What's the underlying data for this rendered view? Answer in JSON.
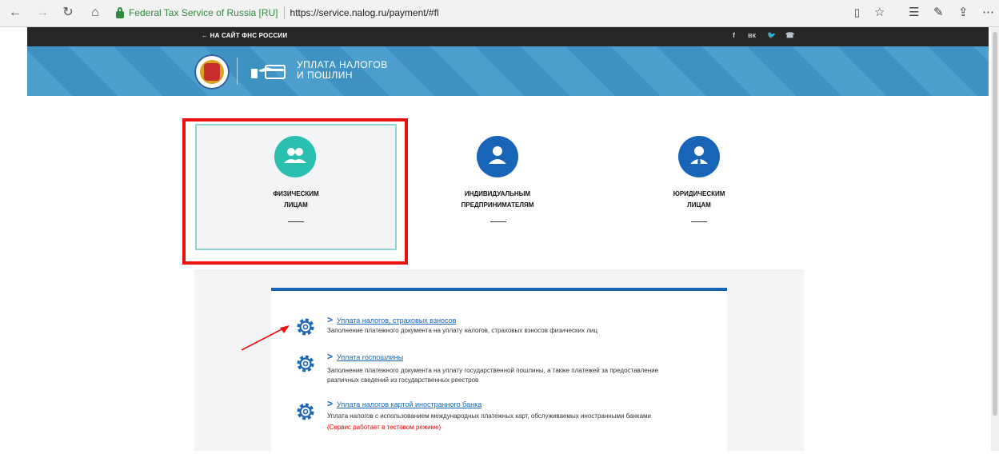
{
  "browser": {
    "secure_label": "Federal Tax Service of Russia [RU]",
    "url": "https://service.nalog.ru/payment/#fl"
  },
  "topbar": {
    "back_link": "← НА САЙТ ФНС РОССИИ",
    "social": [
      "f",
      "вк",
      "tw",
      "tel"
    ]
  },
  "banner": {
    "title_line1": "УПЛАТА НАЛОГОВ",
    "title_line2": "И ПОШЛИН"
  },
  "categories": [
    {
      "line1": "ФИЗИЧЕСКИМ",
      "line2": "ЛИЦАМ"
    },
    {
      "line1": "ИНДИВИДУАЛЬНЫМ",
      "line2": "ПРЕДПРИНИМАТЕЛЯМ"
    },
    {
      "line1": "ЮРИДИЧЕСКИМ",
      "line2": "ЛИЦАМ"
    }
  ],
  "services": [
    {
      "title": "Уплата налогов, страховых взносов",
      "desc": "Заполнение платежного документа на уплату налогов, страховых взносов физических лиц"
    },
    {
      "title": "Уплата госпошлины",
      "desc1": "Заполнение платежного документа на уплату государственной пошлины, а также платежей за предоставление",
      "desc2": "различных сведений из государственных реестров"
    },
    {
      "title": "Уплата налогов картой иностранного банка",
      "desc": "Уплата налогов с использованием международных платежных карт, обслуживаемых иностранными банками",
      "note": "(Сервис работает в тестовом режиме)"
    }
  ],
  "colors": {
    "accent_teal": "#2abfae",
    "brand_blue": "#1865b8",
    "highlight_red": "#e11"
  }
}
